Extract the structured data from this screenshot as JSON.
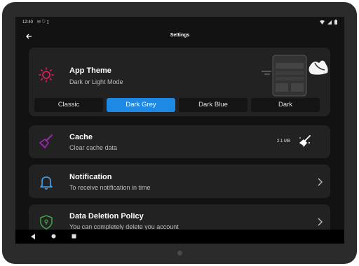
{
  "status_bar": {
    "time": "12:40",
    "icons": [
      "gmail-icon",
      "shield-icon",
      "sim-icon"
    ]
  },
  "app_bar": {
    "title": "Settings",
    "back_icon": "back-arrow-icon"
  },
  "theme": {
    "title": "App Theme",
    "subtitle": "Dark or Light Mode",
    "options": [
      "Classic",
      "Dark Grey",
      "Dark Blue",
      "Dark"
    ],
    "selected": "Dark Grey"
  },
  "cache": {
    "title": "Cache",
    "subtitle": "Clear cache data",
    "size": "2.1 MB"
  },
  "notification": {
    "title": "Notification",
    "subtitle": "To receive notification in time"
  },
  "data_deletion": {
    "title": "Data Deletion Policy",
    "subtitle": "You can completely delete you account"
  },
  "colors": {
    "accent": "#1e88e5",
    "sun": "#e91e63",
    "cache": "#9c27b0",
    "bell": "#42a5f5",
    "shield": "#43a047"
  }
}
